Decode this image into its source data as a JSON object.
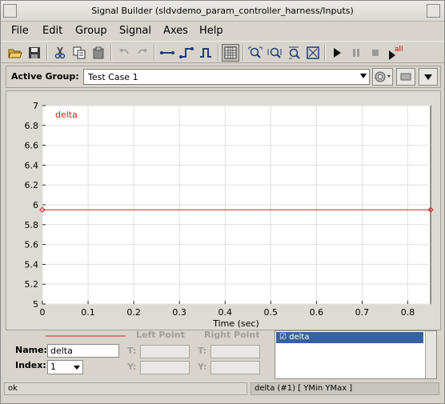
{
  "window": {
    "title": "Signal Builder (sldvdemo_param_controller_harness/Inputs)"
  },
  "menu": {
    "file": "File",
    "edit": "Edit",
    "group": "Group",
    "signal": "Signal",
    "axes": "Axes",
    "help": "Help"
  },
  "toolbar": {
    "icons": [
      "open-icon",
      "save-icon",
      "cut-icon",
      "copy-icon",
      "paste-icon",
      "undo-icon",
      "redo-icon",
      "constant-icon",
      "step-icon",
      "pulse-icon",
      "grid-icon",
      "zoom-xy-icon",
      "zoom-x-icon",
      "zoom-y-icon",
      "fit-icon",
      "start-icon",
      "pause-icon",
      "stop-icon",
      "run-all-icon"
    ],
    "run_all_label": "all"
  },
  "active_group": {
    "label": "Active Group:",
    "value": "Test Case 1"
  },
  "chart_data": {
    "type": "line",
    "series": [
      {
        "name": "delta",
        "x": [
          0,
          0.85
        ],
        "y": [
          5.95,
          5.95
        ],
        "color": "#d42020"
      }
    ],
    "xlabel": "Time (sec)",
    "xlim": [
      0,
      0.85
    ],
    "ylim": [
      5,
      7
    ],
    "xticks": [
      "0",
      "0.1",
      "0.2",
      "0.3",
      "0.4",
      "0.5",
      "0.6",
      "0.7",
      "0.8"
    ],
    "yticks": [
      "5",
      "5.2",
      "5.4",
      "5.6",
      "5.8",
      "6",
      "6.2",
      "6.4",
      "6.6",
      "6.8",
      "7"
    ],
    "grid": true
  },
  "points": {
    "name_label": "Name:",
    "name_value": "delta",
    "index_label": "Index:",
    "index_value": "1",
    "left_point": "Left Point",
    "right_point": "Right Point",
    "t_label": "T:",
    "y_label": "Y:"
  },
  "signal_list": {
    "items": [
      "delta"
    ]
  },
  "status": {
    "left": "ok",
    "right": "delta (#1)  [ YMin YMax ]"
  }
}
